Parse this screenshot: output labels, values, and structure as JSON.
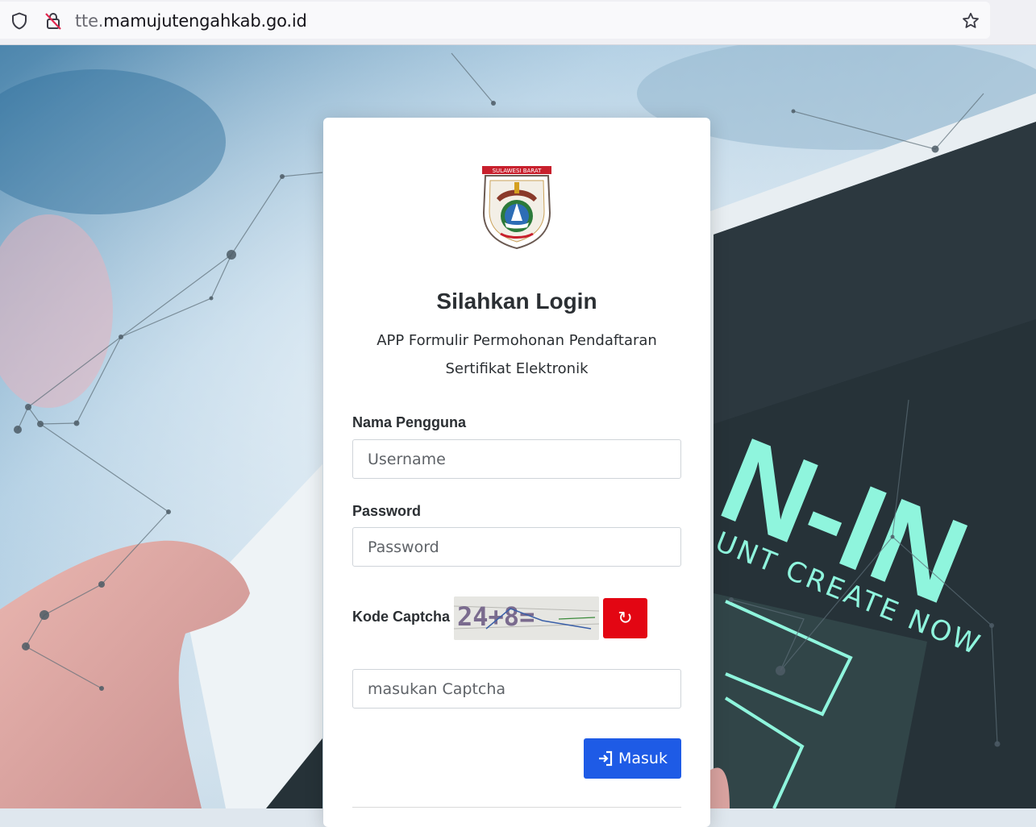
{
  "browser": {
    "url_prefix": "tte.",
    "url_domain": "mamujutengahkab.go.id",
    "icons": [
      "shield-icon",
      "lock-slash-icon",
      "star-icon"
    ]
  },
  "background": {
    "screen_text_large": "N-IN",
    "screen_text_small": "UNT CREATE NOW"
  },
  "login": {
    "logo_banner": "SULAWESI BARAT",
    "title": "Silahkan Login",
    "subtitle_line1": "APP Formulir Permohonan Pendaftaran",
    "subtitle_line2": "Sertifikat Elektronik",
    "username_label": "Nama Pengguna",
    "username_placeholder": "Username",
    "password_label": "Password",
    "password_placeholder": "Password",
    "captcha_label": "Kode Captcha",
    "captcha_text": "24+8=",
    "refresh_glyph": "↻",
    "captcha_placeholder": "masukan Captcha",
    "submit_label": "Masuk"
  },
  "colors": {
    "submit": "#1e5be6",
    "refresh": "#e30613",
    "screen_text": "#8ff5dd"
  }
}
